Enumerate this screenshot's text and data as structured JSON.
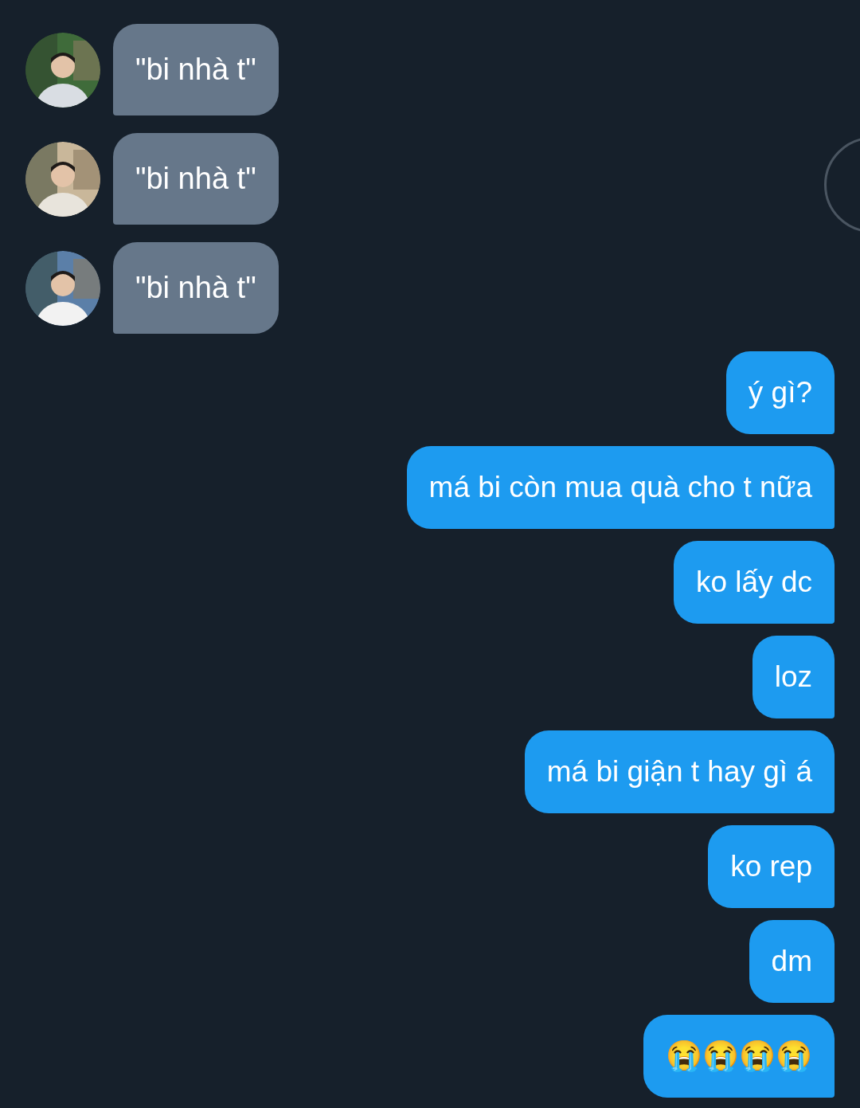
{
  "messages": [
    {
      "kind": "incoming",
      "text": "\"bi nhà t\""
    },
    {
      "kind": "incoming",
      "text": "\"bi nhà t\""
    },
    {
      "kind": "incoming",
      "text": "\"bi nhà t\""
    },
    {
      "kind": "outgoing",
      "text": "ý gì?"
    },
    {
      "kind": "outgoing",
      "text": "má bi còn mua quà cho t nữa"
    },
    {
      "kind": "outgoing",
      "text": "ko lấy dc"
    },
    {
      "kind": "outgoing",
      "text": "loz"
    },
    {
      "kind": "outgoing",
      "text": "má bi giận t hay gì á"
    },
    {
      "kind": "outgoing",
      "text": "ko rep"
    },
    {
      "kind": "outgoing",
      "text": "dm"
    },
    {
      "kind": "outgoing",
      "text": "😭😭😭😭"
    }
  ]
}
